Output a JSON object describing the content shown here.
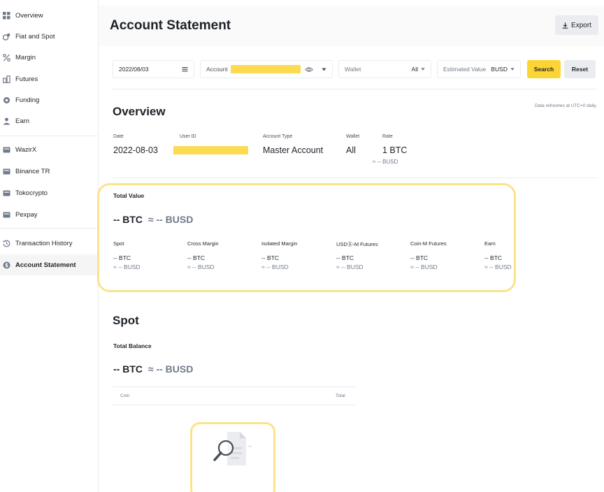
{
  "sidebar": {
    "items": [
      {
        "label": "Overview",
        "icon": "grid-icon"
      },
      {
        "label": "Fiat and Spot",
        "icon": "wallet-icon"
      },
      {
        "label": "Margin",
        "icon": "percent-icon"
      },
      {
        "label": "Futures",
        "icon": "futures-icon"
      },
      {
        "label": "Funding",
        "icon": "funding-icon"
      },
      {
        "label": "Earn",
        "icon": "earn-icon"
      },
      {
        "label": "WazirX",
        "icon": "card-icon"
      },
      {
        "label": "Binance TR",
        "icon": "card-icon"
      },
      {
        "label": "Tokocrypto",
        "icon": "card-icon"
      },
      {
        "label": "Pexpay",
        "icon": "card-icon"
      },
      {
        "label": "Transaction History",
        "icon": "history-icon"
      },
      {
        "label": "Account Statement",
        "icon": "statement-icon"
      }
    ],
    "active": "Account Statement"
  },
  "header": {
    "title": "Account Statement",
    "export_label": "Export"
  },
  "filters": {
    "date": "2022/08/03",
    "account_label": "Account",
    "wallet_label": "Wallet",
    "wallet_value": "All",
    "estimated_label": "Estimated Value",
    "estimated_value": "BUSD",
    "search_label": "Search",
    "reset_label": "Reset"
  },
  "overview": {
    "title": "Overview",
    "refresh_note": "Data refreshes at UTC+0 daily.",
    "date_label": "Date",
    "date_value": "2022-08-03",
    "user_id_label": "User ID",
    "account_type_label": "Account Type",
    "account_type_value": "Master Account",
    "wallet_label": "Wallet",
    "wallet_value": "All",
    "rate_label": "Rate",
    "rate_value": "1 BTC",
    "rate_sub": "≈ -- BUSD"
  },
  "total_value": {
    "label": "Total Value",
    "btc": "-- BTC",
    "busd": "≈ -- BUSD",
    "columns": [
      {
        "label": "Spot",
        "btc": "-- BTC",
        "busd": "≈ -- BUSD"
      },
      {
        "label": "Cross Margin",
        "btc": "-- BTC",
        "busd": "≈ -- BUSD"
      },
      {
        "label": "Isolated Margin",
        "btc": "-- BTC",
        "busd": "≈ -- BUSD"
      },
      {
        "label": "USDⓈ-M Futures",
        "btc": "-- BTC",
        "busd": "≈ -- BUSD"
      },
      {
        "label": "Coin-M Futures",
        "btc": "-- BTC",
        "busd": "≈ -- BUSD"
      },
      {
        "label": "Earn",
        "btc": "-- BTC",
        "busd": "≈ -- BUSD"
      }
    ]
  },
  "spot": {
    "title": "Spot",
    "total_balance_label": "Total Balance",
    "btc": "-- BTC",
    "busd": "≈ -- BUSD",
    "table_headers": {
      "coin": "Coin",
      "total": "Total"
    }
  },
  "colors": {
    "accent": "#fcd535",
    "highlight": "#fce38a",
    "text": "#1e2329",
    "muted": "#707a8a"
  }
}
